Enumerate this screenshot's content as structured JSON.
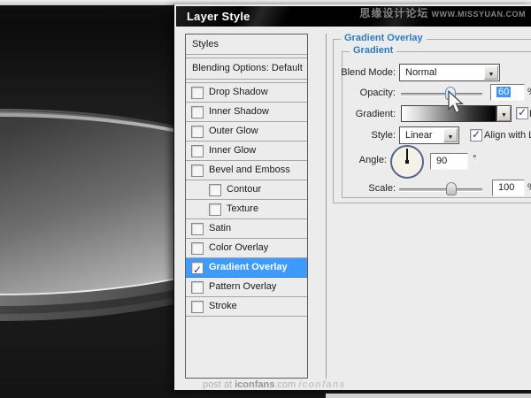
{
  "window": {
    "title": "Layer Style"
  },
  "watermarks": {
    "top_cn": "思缘设计论坛",
    "top_url": "WWW.MISSYUAN.COM",
    "bottom_prefix": "post at ",
    "bottom_site": "iconfans",
    "bottom_suffix": ".com",
    "bottom_logo": "iconfans"
  },
  "styles_panel": {
    "header": "Styles",
    "blending": "Blending Options: Default",
    "items": [
      {
        "label": "Drop Shadow",
        "checked": false,
        "indent": false,
        "selected": false
      },
      {
        "label": "Inner Shadow",
        "checked": false,
        "indent": false,
        "selected": false
      },
      {
        "label": "Outer Glow",
        "checked": false,
        "indent": false,
        "selected": false
      },
      {
        "label": "Inner Glow",
        "checked": false,
        "indent": false,
        "selected": false
      },
      {
        "label": "Bevel and Emboss",
        "checked": false,
        "indent": false,
        "selected": false
      },
      {
        "label": "Contour",
        "checked": false,
        "indent": true,
        "selected": false
      },
      {
        "label": "Texture",
        "checked": false,
        "indent": true,
        "selected": false
      },
      {
        "label": "Satin",
        "checked": false,
        "indent": false,
        "selected": false
      },
      {
        "label": "Color Overlay",
        "checked": false,
        "indent": false,
        "selected": false
      },
      {
        "label": "Gradient Overlay",
        "checked": true,
        "indent": false,
        "selected": true
      },
      {
        "label": "Pattern Overlay",
        "checked": false,
        "indent": false,
        "selected": false
      },
      {
        "label": "Stroke",
        "checked": false,
        "indent": false,
        "selected": false
      }
    ]
  },
  "gradient_overlay": {
    "section_title": "Gradient Overlay",
    "group_title": "Gradient",
    "blend_mode": {
      "label": "Blend Mode:",
      "value": "Normal"
    },
    "opacity": {
      "label": "Opacity:",
      "value": "60",
      "unit": "%"
    },
    "gradient": {
      "label": "Gradient:",
      "reverse_label": "Re"
    },
    "style": {
      "label": "Style:",
      "value": "Linear",
      "align_label": "Align with L"
    },
    "angle": {
      "label": "Angle:",
      "value": "90",
      "unit": "°"
    },
    "scale": {
      "label": "Scale:",
      "value": "100",
      "unit": "%"
    }
  },
  "colors": {
    "selected_item_bg": "#3d9bfd",
    "section_header_text": "#2b7cc4",
    "value_selection_bg": "#3d94f6",
    "dialog_bg": "#ececec",
    "titlebar_bg": "#000000"
  }
}
